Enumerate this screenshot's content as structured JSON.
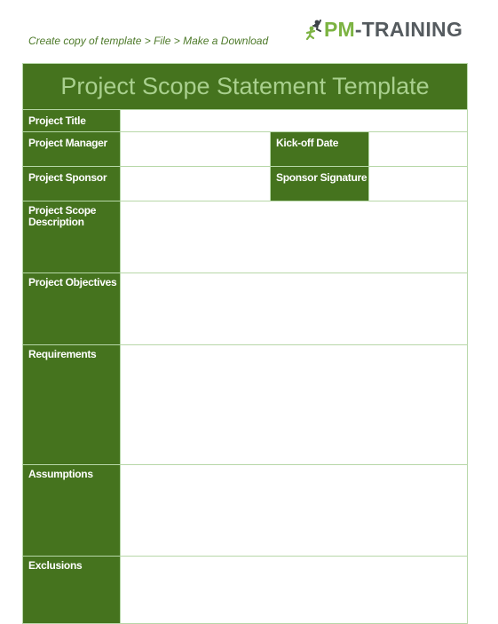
{
  "instructions": "Create copy of template > File > Make a Download",
  "logo": {
    "icon": "runner-icon",
    "pm": "PM",
    "dash": "-",
    "rest": "TRAINING"
  },
  "document": {
    "title": "Project Scope Statement Template",
    "fields": {
      "project_title": {
        "label": "Project Title",
        "value": ""
      },
      "project_manager": {
        "label": "Project Manager",
        "value": ""
      },
      "kickoff_date": {
        "label": "Kick-off Date",
        "value": ""
      },
      "project_sponsor": {
        "label": "Project Sponsor",
        "value": ""
      },
      "sponsor_signature": {
        "label": "Sponsor Signature",
        "value": ""
      },
      "scope_description": {
        "label": "Project Scope Description",
        "value": ""
      },
      "objectives": {
        "label": "Project Objectives",
        "value": ""
      },
      "requirements": {
        "label": "Requirements",
        "value": ""
      },
      "assumptions": {
        "label": "Assumptions",
        "value": ""
      },
      "exclusions": {
        "label": "Exclusions",
        "value": ""
      }
    }
  },
  "colors": {
    "header_green": "#45731e",
    "title_text": "#a9d08e",
    "border": "#b7d7a8",
    "logo_green": "#7cb342",
    "logo_gray": "#555b5f",
    "hint_text": "#4e7a2a"
  }
}
